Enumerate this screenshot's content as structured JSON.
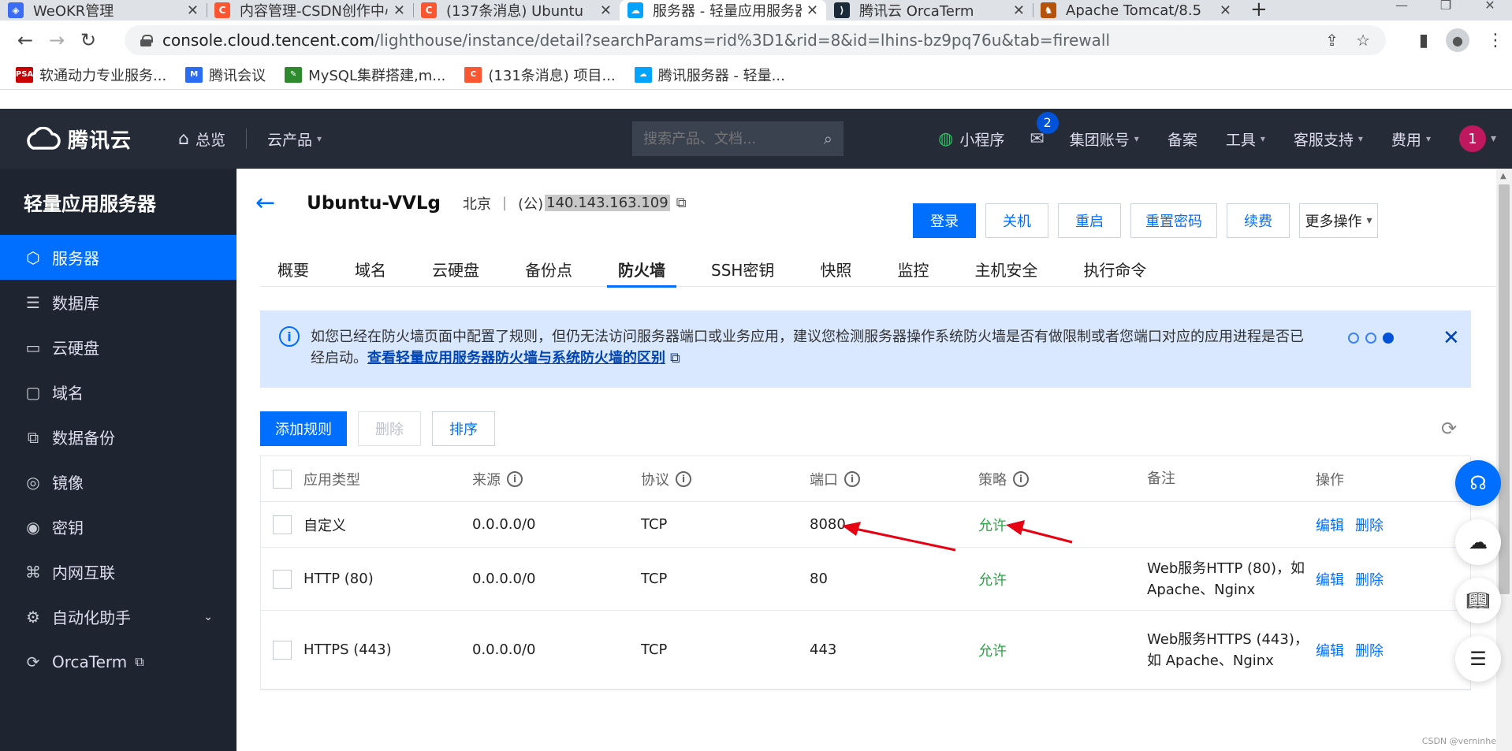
{
  "browser": {
    "tabs": [
      {
        "title": "WeOKR管理",
        "favicon_color": "#3b6cf6",
        "favicon_glyph": "◈"
      },
      {
        "title": "内容管理-CSDN创作中心",
        "favicon_color": "#fc5531",
        "favicon_glyph": "C"
      },
      {
        "title": "(137条消息) Ubuntu",
        "favicon_color": "#fc5531",
        "favicon_glyph": "C"
      },
      {
        "title": "服务器 - 轻量应用服务器",
        "favicon_color": "#00a3ff",
        "favicon_glyph": "☁"
      },
      {
        "title": "腾讯云 OrcaTerm",
        "favicon_color": "#1c2b3a",
        "favicon_glyph": "⟩"
      },
      {
        "title": "Apache Tomcat/8.5",
        "favicon_color": "#b45309",
        "favicon_glyph": "♞"
      }
    ],
    "new_tab": "+",
    "url_host": "console.cloud.tencent.com",
    "url_path": "/lighthouse/instance/detail?searchParams=rid%3D1&rid=8&id=lhins-bz9pq76u&tab=firewall",
    "bookmarks": [
      {
        "label": "软通动力专业服务...",
        "favicon_color": "#c00",
        "favicon_glyph": "PSA"
      },
      {
        "label": "腾讯会议",
        "favicon_color": "#2b6cf6",
        "favicon_glyph": "M"
      },
      {
        "label": "MySQL集群搭建,m...",
        "favicon_color": "#2d8a2d",
        "favicon_glyph": "✎"
      },
      {
        "label": "(131条消息) 项目...",
        "favicon_color": "#fc5531",
        "favicon_glyph": "C"
      },
      {
        "label": "腾讯服务器 - 轻量...",
        "favicon_color": "#00a3ff",
        "favicon_glyph": "☁"
      }
    ]
  },
  "topnav": {
    "brand": "腾讯云",
    "overview": "总览",
    "products": "云产品",
    "search_placeholder": "搜索产品、文档...",
    "miniprogram": "小程序",
    "mail_badge": "2",
    "account": "集团账号",
    "beian": "备案",
    "tools": "工具",
    "support": "客服支持",
    "billing": "费用",
    "user_badge": "1"
  },
  "sidebar": {
    "title": "轻量应用服务器",
    "items": [
      {
        "label": "服务器",
        "icon": "cube-icon",
        "glyph": "⬡"
      },
      {
        "label": "数据库",
        "icon": "database-icon",
        "glyph": "☰"
      },
      {
        "label": "云硬盘",
        "icon": "disk-icon",
        "glyph": "▭"
      },
      {
        "label": "域名",
        "icon": "domain-icon",
        "glyph": "▢"
      },
      {
        "label": "数据备份",
        "icon": "backup-icon",
        "glyph": "⧉"
      },
      {
        "label": "镜像",
        "icon": "image-icon",
        "glyph": "◎"
      },
      {
        "label": "密钥",
        "icon": "key-icon",
        "glyph": "◉"
      },
      {
        "label": "内网互联",
        "icon": "network-icon",
        "glyph": "⌘"
      },
      {
        "label": "自动化助手",
        "icon": "automation-icon",
        "glyph": "⚙"
      },
      {
        "label": "OrcaTerm",
        "icon": "terminal-icon",
        "glyph": "⟳"
      }
    ]
  },
  "instance": {
    "name": "Ubuntu-VVLg",
    "region": "北京",
    "separator": "|",
    "ip_label": "(公)",
    "ip": "140.143.163.109"
  },
  "actions": {
    "login": "登录",
    "shutdown": "关机",
    "restart": "重启",
    "reset_password": "重置密码",
    "renew": "续费",
    "more": "更多操作"
  },
  "tabs": [
    "概要",
    "域名",
    "云硬盘",
    "备份点",
    "防火墙",
    "SSH密钥",
    "快照",
    "监控",
    "主机安全",
    "执行命令"
  ],
  "active_tab": "防火墙",
  "alert": {
    "text": "如您已经在防火墙页面中配置了规则，但仍无法访问服务器端口或业务应用，建议您检测服务器操作系统防火墙是否有做限制或者您端口对应的应用进程是否已经启动。",
    "link": "查看轻量应用服务器防火墙与系统防火墙的区别"
  },
  "toolbar": {
    "add_rule": "添加规则",
    "delete": "删除",
    "sort": "排序"
  },
  "table": {
    "headers": {
      "app_type": "应用类型",
      "source": "来源",
      "protocol": "协议",
      "port": "端口",
      "policy": "策略",
      "remark": "备注",
      "operation": "操作"
    },
    "rows": [
      {
        "app_type": "自定义",
        "source": "0.0.0.0/0",
        "protocol": "TCP",
        "port": "8080",
        "policy": "允许",
        "remark": "",
        "edit": "编辑",
        "delete": "删除"
      },
      {
        "app_type": "HTTP (80)",
        "source": "0.0.0.0/0",
        "protocol": "TCP",
        "port": "80",
        "policy": "允许",
        "remark": "Web服务HTTP (80)，如 Apache、Nginx",
        "edit": "编辑",
        "delete": "删除"
      },
      {
        "app_type": "HTTPS (443)",
        "source": "0.0.0.0/0",
        "protocol": "TCP",
        "port": "443",
        "policy": "允许",
        "remark": "Web服务HTTPS (443)，如 Apache、Nginx",
        "edit": "编辑",
        "delete": "删除"
      }
    ]
  },
  "watermark": "CSDN @verninhe",
  "colors": {
    "accent": "#006eff",
    "allow": "#29a745",
    "nav_bg": "#252c38",
    "sidebar_bg": "#1e2530",
    "annotation_arrow": "#e60012"
  }
}
